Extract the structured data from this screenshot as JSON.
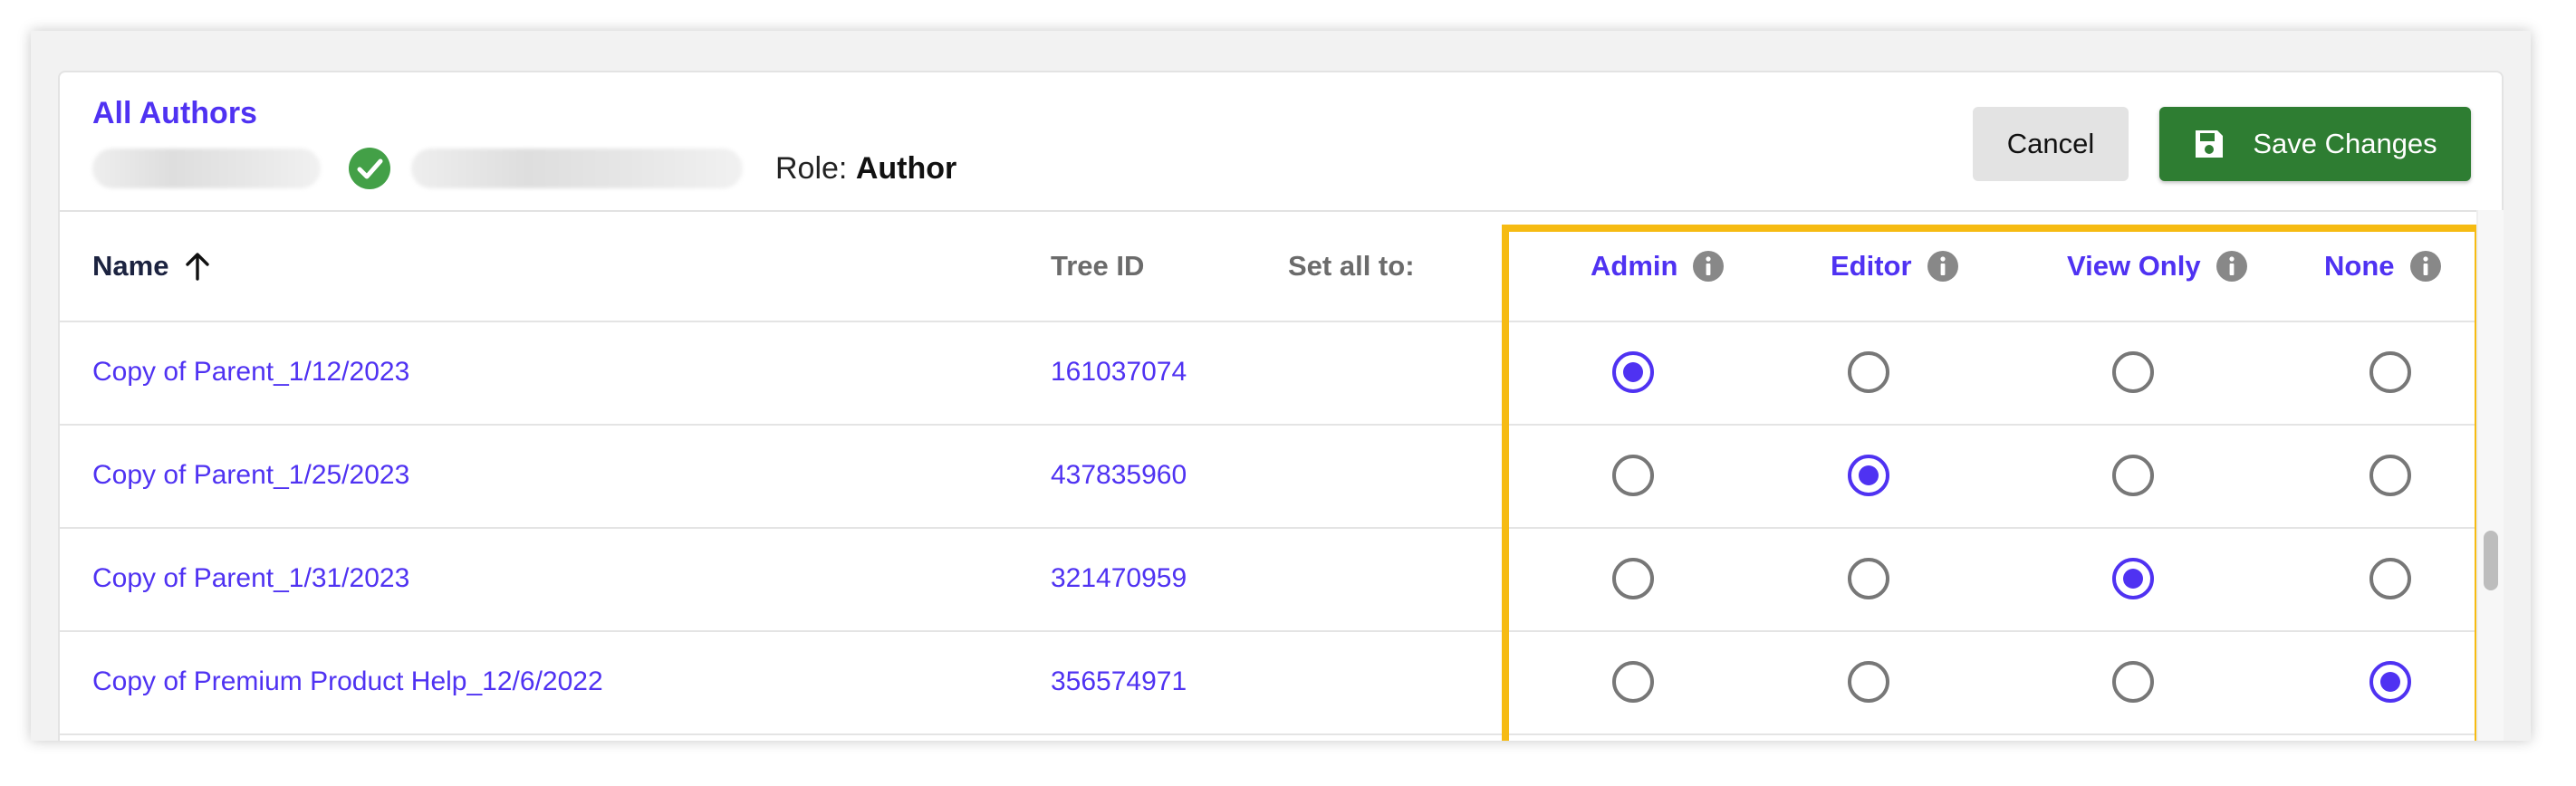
{
  "header": {
    "breadcrumb": "All Authors",
    "role_label": "Role:",
    "role_value": "Author",
    "cancel_label": "Cancel",
    "save_label": "Save Changes"
  },
  "table": {
    "columns": {
      "name": "Name",
      "tree_id": "Tree ID",
      "set_all": "Set all to:",
      "permissions": [
        "Admin",
        "Editor",
        "View Only",
        "None"
      ]
    },
    "rows": [
      {
        "name": "Copy of Parent_1/12/2023",
        "tree_id": "161037074",
        "selected": "Admin"
      },
      {
        "name": "Copy of Parent_1/25/2023",
        "tree_id": "437835960",
        "selected": "Editor"
      },
      {
        "name": "Copy of Parent_1/31/2023",
        "tree_id": "321470959",
        "selected": "View Only"
      },
      {
        "name": "Copy of Premium Product Help_12/6/2022",
        "tree_id": "356574971",
        "selected": "None"
      }
    ]
  },
  "colors": {
    "accent": "#4f32f2",
    "save_button": "#2e7d32",
    "highlight": "#f6bb12",
    "verified": "#43a047"
  },
  "icons": {
    "verified": "check-circle-icon",
    "save": "floppy-disk-icon",
    "sort": "arrow-up-icon",
    "info": "info-circle-icon"
  }
}
